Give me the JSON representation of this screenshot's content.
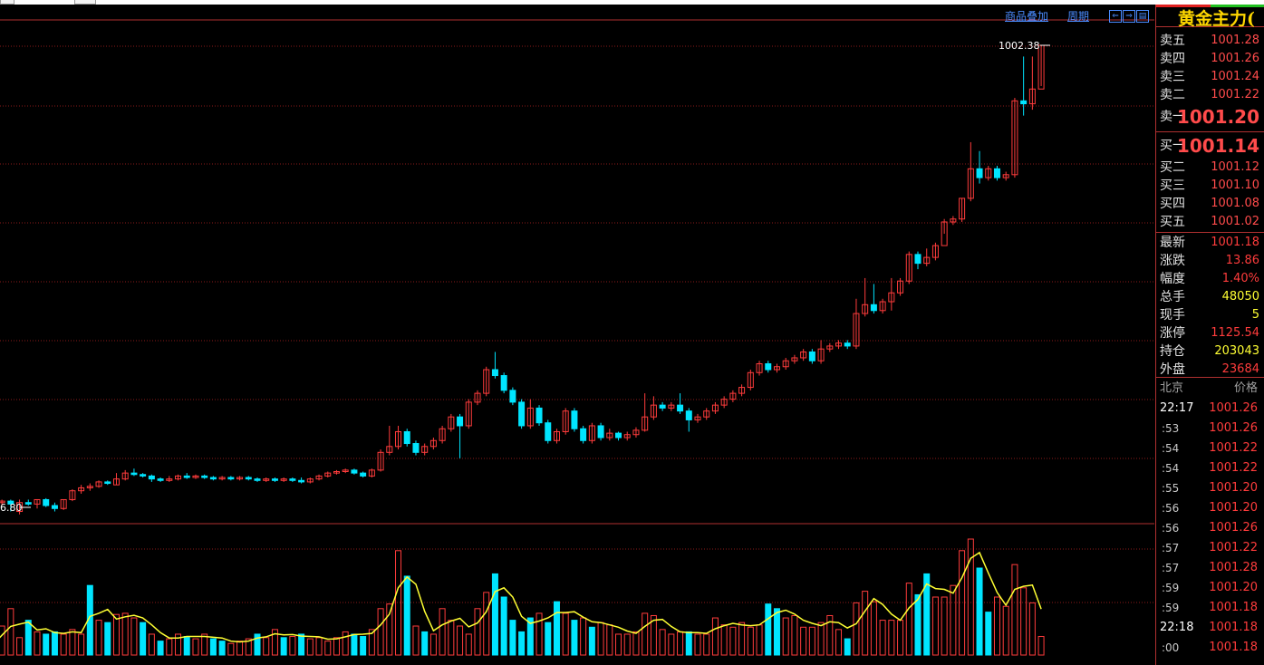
{
  "toolbar": {
    "overlay_label": "商品叠加",
    "period_label": "周期",
    "nav_left": "⇐",
    "nav_right": "⇒",
    "nav_grid": "▤"
  },
  "price_labels": {
    "high": "1002.38",
    "low": "6.80"
  },
  "colors": {
    "up": "#ff3c3c",
    "down": "#00e5ff",
    "ma_line": "#ffff33",
    "grid": "#8b1a1a",
    "bg": "#000000"
  },
  "quote": {
    "title": "黄金主力(",
    "sell": [
      {
        "label": "卖五",
        "price": "1001.28"
      },
      {
        "label": "卖四",
        "price": "1001.26"
      },
      {
        "label": "卖三",
        "price": "1001.24"
      },
      {
        "label": "卖二",
        "price": "1001.22"
      },
      {
        "label": "卖一",
        "price": "1001.20"
      }
    ],
    "buy": [
      {
        "label": "买一",
        "price": "1001.14"
      },
      {
        "label": "买二",
        "price": "1001.12"
      },
      {
        "label": "买三",
        "price": "1001.10"
      },
      {
        "label": "买四",
        "price": "1001.08"
      },
      {
        "label": "买五",
        "price": "1001.02"
      }
    ],
    "stats": [
      {
        "label": "最新",
        "value": "1001.18",
        "color": "#ff3c3c"
      },
      {
        "label": "涨跌",
        "value": "13.86",
        "color": "#ff3c3c"
      },
      {
        "label": "幅度",
        "value": "1.40%",
        "color": "#ff3c3c"
      },
      {
        "label": "总手",
        "value": "48050",
        "color": "#ffff33"
      },
      {
        "label": "现手",
        "value": "5",
        "color": "#ffff33"
      },
      {
        "label": "涨停",
        "value": "1125.54",
        "color": "#ff3c3c"
      },
      {
        "label": "持仓",
        "value": "203043",
        "color": "#ffff33"
      },
      {
        "label": "外盘",
        "value": "23684",
        "color": "#ff3c3c"
      }
    ]
  },
  "ticks": {
    "header_left": "北京",
    "header_right": "价格",
    "rows": [
      {
        "time": "22:17",
        "price": "1001.26"
      },
      {
        "time": ":53",
        "price": "1001.26"
      },
      {
        "time": ":54",
        "price": "1001.22"
      },
      {
        "time": ":54",
        "price": "1001.22"
      },
      {
        "time": ":55",
        "price": "1001.20"
      },
      {
        "time": ":56",
        "price": "1001.20"
      },
      {
        "time": ":56",
        "price": "1001.26"
      },
      {
        "time": ":57",
        "price": "1001.22"
      },
      {
        "time": ":57",
        "price": "1001.28"
      },
      {
        "time": ":59",
        "price": "1001.20"
      },
      {
        "time": ":59",
        "price": "1001.18"
      },
      {
        "time": "22:18",
        "price": "1001.18"
      },
      {
        "time": ":00",
        "price": "1001.18"
      }
    ]
  },
  "chart_data": {
    "type": "candlestick",
    "max_price_label": "1002.38",
    "min_price_label_partial": "6.80",
    "candles": [
      [
        0,
        987.0,
        986.9,
        987.1,
        986.8
      ],
      [
        1,
        986.9,
        986.95,
        987.0,
        986.8
      ],
      [
        2,
        986.95,
        986.85,
        987.0,
        986.6
      ],
      [
        3,
        986.6,
        986.9,
        987.0,
        986.5
      ],
      [
        4,
        986.9,
        986.85,
        987.0,
        986.8
      ],
      [
        5,
        986.85,
        987.0,
        987.0,
        986.7
      ],
      [
        6,
        987.0,
        986.8,
        987.05,
        986.75
      ],
      [
        7,
        986.8,
        986.7,
        986.9,
        986.6
      ],
      [
        8,
        986.7,
        987.0,
        987.0,
        986.65
      ],
      [
        9,
        987.0,
        987.3,
        987.35,
        986.95
      ],
      [
        10,
        987.3,
        987.4,
        987.5,
        987.2
      ],
      [
        11,
        987.4,
        987.45,
        987.55,
        987.3
      ],
      [
        12,
        987.45,
        987.6,
        987.65,
        987.4
      ],
      [
        13,
        987.6,
        987.55,
        987.65,
        987.5
      ],
      [
        14,
        987.5,
        987.7,
        987.9,
        987.5
      ],
      [
        15,
        987.7,
        987.9,
        988.0,
        987.65
      ],
      [
        16,
        987.9,
        987.85,
        988.05,
        987.8
      ],
      [
        17,
        987.85,
        987.8,
        987.9,
        987.75
      ],
      [
        18,
        987.8,
        987.7,
        987.85,
        987.6
      ],
      [
        19,
        987.7,
        987.65,
        987.75,
        987.6
      ],
      [
        20,
        987.65,
        987.7,
        987.8,
        987.6
      ],
      [
        21,
        987.7,
        987.8,
        987.85,
        987.65
      ],
      [
        22,
        987.8,
        987.75,
        987.9,
        987.7
      ],
      [
        23,
        987.75,
        987.8,
        987.85,
        987.7
      ],
      [
        24,
        987.8,
        987.75,
        987.85,
        987.7
      ],
      [
        25,
        987.75,
        987.7,
        987.8,
        987.65
      ],
      [
        26,
        987.7,
        987.75,
        987.8,
        987.65
      ],
      [
        27,
        987.75,
        987.7,
        987.8,
        987.65
      ],
      [
        28,
        987.7,
        987.75,
        987.8,
        987.65
      ],
      [
        29,
        987.75,
        987.7,
        987.8,
        987.65
      ],
      [
        30,
        987.7,
        987.65,
        987.75,
        987.6
      ],
      [
        31,
        987.65,
        987.7,
        987.75,
        987.6
      ],
      [
        32,
        987.7,
        987.65,
        987.75,
        987.6
      ],
      [
        33,
        987.65,
        987.7,
        987.75,
        987.6
      ],
      [
        34,
        987.7,
        987.65,
        987.75,
        987.6
      ],
      [
        35,
        987.65,
        987.6,
        987.75,
        987.55
      ],
      [
        36,
        987.6,
        987.7,
        987.75,
        987.55
      ],
      [
        37,
        987.7,
        987.8,
        987.85,
        987.65
      ],
      [
        38,
        987.8,
        987.9,
        987.95,
        987.75
      ],
      [
        39,
        987.9,
        987.95,
        988.0,
        987.85
      ],
      [
        40,
        987.95,
        988.0,
        988.05,
        987.9
      ],
      [
        41,
        988.0,
        987.9,
        988.05,
        987.85
      ],
      [
        42,
        987.9,
        987.8,
        987.95,
        987.75
      ],
      [
        43,
        987.8,
        988.0,
        988.05,
        987.75
      ],
      [
        44,
        988.0,
        988.6,
        988.7,
        987.95
      ],
      [
        45,
        988.6,
        988.8,
        989.5,
        988.5
      ],
      [
        46,
        988.8,
        989.3,
        989.5,
        988.7
      ],
      [
        47,
        989.3,
        988.9,
        989.4,
        988.8
      ],
      [
        48,
        988.9,
        988.6,
        989.0,
        988.5
      ],
      [
        49,
        988.6,
        988.8,
        988.9,
        988.5
      ],
      [
        50,
        988.8,
        989.0,
        989.1,
        988.7
      ],
      [
        51,
        989.0,
        989.4,
        989.5,
        988.9
      ],
      [
        52,
        989.4,
        989.8,
        989.9,
        989.3
      ],
      [
        53,
        989.8,
        989.5,
        989.9,
        988.4
      ],
      [
        54,
        989.5,
        990.3,
        990.4,
        989.4
      ],
      [
        55,
        990.3,
        990.6,
        990.7,
        990.2
      ],
      [
        56,
        990.6,
        991.4,
        991.5,
        990.5
      ],
      [
        57,
        991.4,
        991.2,
        992.0,
        991.1
      ],
      [
        58,
        991.2,
        990.7,
        991.3,
        990.6
      ],
      [
        59,
        990.7,
        990.3,
        990.8,
        990.2
      ],
      [
        60,
        990.3,
        989.5,
        990.4,
        989.4
      ],
      [
        61,
        989.5,
        990.1,
        990.4,
        989.4
      ],
      [
        62,
        990.1,
        989.6,
        990.2,
        989.5
      ],
      [
        63,
        989.6,
        989.0,
        989.7,
        988.9
      ],
      [
        64,
        989.0,
        989.3,
        989.4,
        988.9
      ],
      [
        65,
        989.3,
        990.0,
        990.1,
        989.2
      ],
      [
        66,
        990.0,
        989.4,
        990.1,
        989.3
      ],
      [
        67,
        989.4,
        989.0,
        989.5,
        988.9
      ],
      [
        68,
        989.0,
        989.5,
        989.6,
        988.9
      ],
      [
        69,
        989.5,
        989.1,
        989.6,
        989.0
      ],
      [
        70,
        989.1,
        989.25,
        989.4,
        989.0
      ],
      [
        71,
        989.25,
        989.1,
        989.3,
        989.0
      ],
      [
        72,
        989.1,
        989.2,
        989.3,
        989.0
      ],
      [
        73,
        989.2,
        989.35,
        989.45,
        989.1
      ],
      [
        74,
        989.35,
        989.8,
        990.6,
        989.3
      ],
      [
        75,
        989.8,
        990.2,
        990.5,
        989.7
      ],
      [
        76,
        990.2,
        990.1,
        990.3,
        990.0
      ],
      [
        77,
        990.1,
        990.2,
        990.3,
        990.0
      ],
      [
        78,
        990.2,
        990.0,
        990.6,
        989.9
      ],
      [
        79,
        990.0,
        989.7,
        990.1,
        989.3
      ],
      [
        80,
        989.7,
        989.8,
        989.9,
        989.6
      ],
      [
        81,
        989.8,
        990.0,
        990.1,
        989.7
      ],
      [
        82,
        990.0,
        990.2,
        990.3,
        989.9
      ],
      [
        83,
        990.2,
        990.4,
        990.5,
        990.1
      ],
      [
        84,
        990.4,
        990.6,
        990.7,
        990.3
      ],
      [
        85,
        990.6,
        990.8,
        990.9,
        990.5
      ],
      [
        86,
        990.8,
        991.3,
        991.4,
        990.7
      ],
      [
        87,
        991.3,
        991.6,
        991.7,
        991.2
      ],
      [
        88,
        991.6,
        991.4,
        991.7,
        991.3
      ],
      [
        89,
        991.4,
        991.5,
        991.6,
        991.3
      ],
      [
        90,
        991.5,
        991.7,
        991.8,
        991.4
      ],
      [
        91,
        991.7,
        991.8,
        991.9,
        991.6
      ],
      [
        92,
        991.8,
        992.0,
        992.1,
        991.7
      ],
      [
        93,
        992.0,
        991.7,
        992.1,
        991.6
      ],
      [
        94,
        991.7,
        992.1,
        992.4,
        991.6
      ],
      [
        95,
        992.1,
        992.2,
        992.3,
        992.0
      ],
      [
        96,
        992.2,
        992.3,
        992.4,
        992.1
      ],
      [
        97,
        992.3,
        992.2,
        992.4,
        992.1
      ],
      [
        98,
        992.2,
        993.3,
        993.8,
        992.1
      ],
      [
        99,
        993.3,
        993.6,
        994.5,
        993.2
      ],
      [
        100,
        993.6,
        993.4,
        994.3,
        993.3
      ],
      [
        101,
        993.4,
        993.7,
        993.8,
        993.3
      ],
      [
        102,
        993.7,
        994.0,
        994.5,
        993.4
      ],
      [
        103,
        994.0,
        994.4,
        994.5,
        993.9
      ],
      [
        104,
        994.4,
        995.3,
        995.4,
        994.3
      ],
      [
        105,
        995.3,
        995.0,
        995.4,
        994.8
      ],
      [
        106,
        995.0,
        995.2,
        995.5,
        994.9
      ],
      [
        107,
        995.2,
        995.6,
        995.7,
        995.1
      ],
      [
        108,
        995.6,
        996.4,
        996.5,
        996.0
      ],
      [
        109,
        996.4,
        996.5,
        996.6,
        996.3
      ],
      [
        110,
        996.5,
        997.2,
        997.2,
        996.4
      ],
      [
        111,
        997.2,
        998.2,
        999.1,
        997.1
      ],
      [
        112,
        998.2,
        997.9,
        998.8,
        997.7
      ],
      [
        113,
        997.9,
        998.2,
        998.3,
        997.8
      ],
      [
        114,
        998.2,
        997.9,
        998.3,
        997.8
      ],
      [
        115,
        997.9,
        998.0,
        998.1,
        997.8
      ],
      [
        116,
        998.0,
        1000.5,
        1000.6,
        997.9
      ],
      [
        117,
        1000.5,
        1000.4,
        1002.0,
        1000.0
      ],
      [
        118,
        1000.4,
        1000.9,
        1002.0,
        1000.2
      ],
      [
        119,
        1000.9,
        1002.38,
        1002.38,
        1001.0
      ]
    ],
    "volume": [
      [
        0,
        9,
        1
      ],
      [
        1,
        25,
        1
      ],
      [
        2,
        40,
        1
      ],
      [
        3,
        15,
        1
      ],
      [
        4,
        30,
        -1
      ],
      [
        5,
        20,
        1
      ],
      [
        6,
        18,
        -1
      ],
      [
        7,
        20,
        -1
      ],
      [
        8,
        18,
        1
      ],
      [
        9,
        22,
        1
      ],
      [
        10,
        18,
        1
      ],
      [
        11,
        60,
        -1
      ],
      [
        12,
        30,
        1
      ],
      [
        13,
        28,
        -1
      ],
      [
        14,
        35,
        1
      ],
      [
        15,
        36,
        1
      ],
      [
        16,
        32,
        1
      ],
      [
        17,
        28,
        -1
      ],
      [
        18,
        18,
        1
      ],
      [
        19,
        12,
        -1
      ],
      [
        20,
        14,
        1
      ],
      [
        21,
        18,
        1
      ],
      [
        22,
        16,
        -1
      ],
      [
        23,
        14,
        1
      ],
      [
        24,
        18,
        1
      ],
      [
        25,
        14,
        -1
      ],
      [
        26,
        12,
        -1
      ],
      [
        27,
        10,
        1
      ],
      [
        28,
        12,
        1
      ],
      [
        29,
        14,
        1
      ],
      [
        30,
        18,
        -1
      ],
      [
        31,
        15,
        1
      ],
      [
        32,
        22,
        1
      ],
      [
        33,
        15,
        -1
      ],
      [
        34,
        16,
        1
      ],
      [
        35,
        18,
        -1
      ],
      [
        36,
        14,
        1
      ],
      [
        37,
        15,
        1
      ],
      [
        38,
        12,
        1
      ],
      [
        39,
        15,
        1
      ],
      [
        40,
        20,
        1
      ],
      [
        41,
        18,
        -1
      ],
      [
        42,
        16,
        -1
      ],
      [
        43,
        22,
        1
      ],
      [
        44,
        40,
        1
      ],
      [
        45,
        44,
        1
      ],
      [
        46,
        90,
        1
      ],
      [
        47,
        68,
        -1
      ],
      [
        48,
        25,
        1
      ],
      [
        49,
        20,
        -1
      ],
      [
        50,
        18,
        1
      ],
      [
        51,
        40,
        1
      ],
      [
        52,
        30,
        1
      ],
      [
        53,
        25,
        1
      ],
      [
        54,
        18,
        1
      ],
      [
        55,
        40,
        1
      ],
      [
        56,
        54,
        1
      ],
      [
        57,
        70,
        -1
      ],
      [
        58,
        50,
        -1
      ],
      [
        59,
        30,
        -1
      ],
      [
        60,
        20,
        -1
      ],
      [
        61,
        32,
        -1
      ],
      [
        62,
        36,
        1
      ],
      [
        63,
        28,
        -1
      ],
      [
        64,
        46,
        -1
      ],
      [
        65,
        36,
        1
      ],
      [
        66,
        30,
        -1
      ],
      [
        67,
        32,
        1
      ],
      [
        68,
        24,
        -1
      ],
      [
        69,
        28,
        1
      ],
      [
        70,
        26,
        1
      ],
      [
        71,
        18,
        1
      ],
      [
        72,
        18,
        1
      ],
      [
        73,
        20,
        1
      ],
      [
        74,
        36,
        1
      ],
      [
        75,
        34,
        1
      ],
      [
        76,
        22,
        1
      ],
      [
        77,
        18,
        1
      ],
      [
        78,
        20,
        1
      ],
      [
        79,
        20,
        -1
      ],
      [
        80,
        18,
        1
      ],
      [
        81,
        18,
        1
      ],
      [
        82,
        32,
        1
      ],
      [
        83,
        26,
        1
      ],
      [
        84,
        24,
        1
      ],
      [
        85,
        28,
        1
      ],
      [
        86,
        24,
        1
      ],
      [
        87,
        26,
        1
      ],
      [
        88,
        44,
        -1
      ],
      [
        89,
        40,
        -1
      ],
      [
        90,
        32,
        1
      ],
      [
        91,
        34,
        1
      ],
      [
        92,
        24,
        1
      ],
      [
        93,
        24,
        1
      ],
      [
        94,
        28,
        1
      ],
      [
        95,
        34,
        1
      ],
      [
        96,
        22,
        1
      ],
      [
        97,
        14,
        -1
      ],
      [
        98,
        45,
        1
      ],
      [
        99,
        55,
        1
      ],
      [
        100,
        46,
        1
      ],
      [
        101,
        30,
        1
      ],
      [
        102,
        30,
        1
      ],
      [
        103,
        30,
        1
      ],
      [
        104,
        62,
        1
      ],
      [
        105,
        52,
        -1
      ],
      [
        106,
        70,
        -1
      ],
      [
        107,
        50,
        1
      ],
      [
        108,
        50,
        1
      ],
      [
        109,
        60,
        1
      ],
      [
        110,
        90,
        1
      ],
      [
        111,
        100,
        1
      ],
      [
        112,
        75,
        -1
      ],
      [
        113,
        37,
        -1
      ],
      [
        114,
        50,
        1
      ],
      [
        115,
        42,
        1
      ],
      [
        116,
        78,
        1
      ],
      [
        117,
        58,
        1
      ],
      [
        118,
        45,
        1
      ],
      [
        119,
        16,
        1
      ]
    ]
  }
}
